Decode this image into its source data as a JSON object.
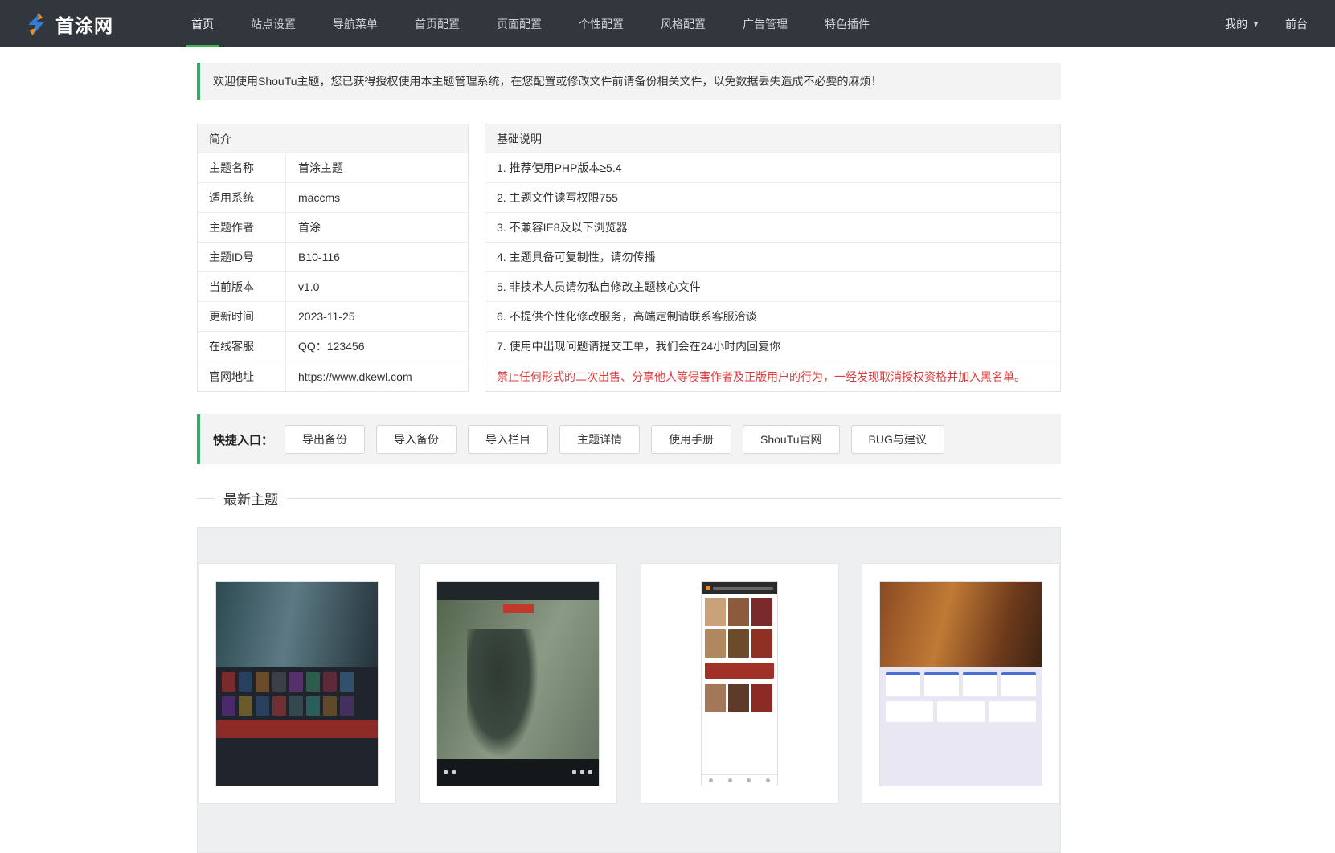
{
  "header": {
    "logo_text": "首涂网",
    "nav": [
      {
        "label": "首页"
      },
      {
        "label": "站点设置"
      },
      {
        "label": "导航菜单"
      },
      {
        "label": "首页配置"
      },
      {
        "label": "页面配置"
      },
      {
        "label": "个性配置"
      },
      {
        "label": "风格配置"
      },
      {
        "label": "广告管理"
      },
      {
        "label": "特色插件"
      }
    ],
    "right": {
      "my": "我的",
      "caret": "▼",
      "front": "前台"
    }
  },
  "alert": {
    "text": "欢迎使用ShouTu主题，您已获得授权使用本主题管理系统，在您配置或修改文件前请备份相关文件，以免数据丢失造成不必要的麻烦！"
  },
  "intro_panel": {
    "title": "简介",
    "rows": [
      {
        "label": "主题名称",
        "value": "首涂主题"
      },
      {
        "label": "适用系统",
        "value": "maccms"
      },
      {
        "label": "主题作者",
        "value": "首涂"
      },
      {
        "label": "主题ID号",
        "value": "B10-116"
      },
      {
        "label": "当前版本",
        "value": "v1.0"
      },
      {
        "label": "更新时间",
        "value": "2023-11-25"
      },
      {
        "label": "在线客服",
        "value": "QQ：123456"
      },
      {
        "label": "官网地址",
        "value": "https://www.dkewl.com"
      }
    ]
  },
  "notes_panel": {
    "title": "基础说明",
    "items": [
      "1. 推荐使用PHP版本≥5.4",
      "2. 主题文件读写权限755",
      "3. 不兼容IE8及以下浏览器",
      "4. 主题具备可复制性，请勿传播",
      "5. 非技术人员请勿私自修改主题核心文件",
      "6. 不提供个性化修改服务，高端定制请联系客服洽谈",
      "7. 使用中出现问题请提交工单，我们会在24小时内回复你"
    ],
    "warning": "禁止任何形式的二次出售、分享他人等侵害作者及正版用户的行为，一经发现取消授权资格并加入黑名单。"
  },
  "quick_entry": {
    "label": "快捷入口：",
    "buttons": [
      "导出备份",
      "导入备份",
      "导入栏目",
      "主题详情",
      "使用手册",
      "ShouTu官网",
      "BUG与建议"
    ]
  },
  "latest_section": {
    "title": "最新主题"
  },
  "colors": {
    "header_bg": "#32373d",
    "accent_green": "#2fae63",
    "nav_active_underline": "#3cb45c",
    "warning_red": "#e03c3c",
    "panel_gray": "#f3f3f3"
  }
}
